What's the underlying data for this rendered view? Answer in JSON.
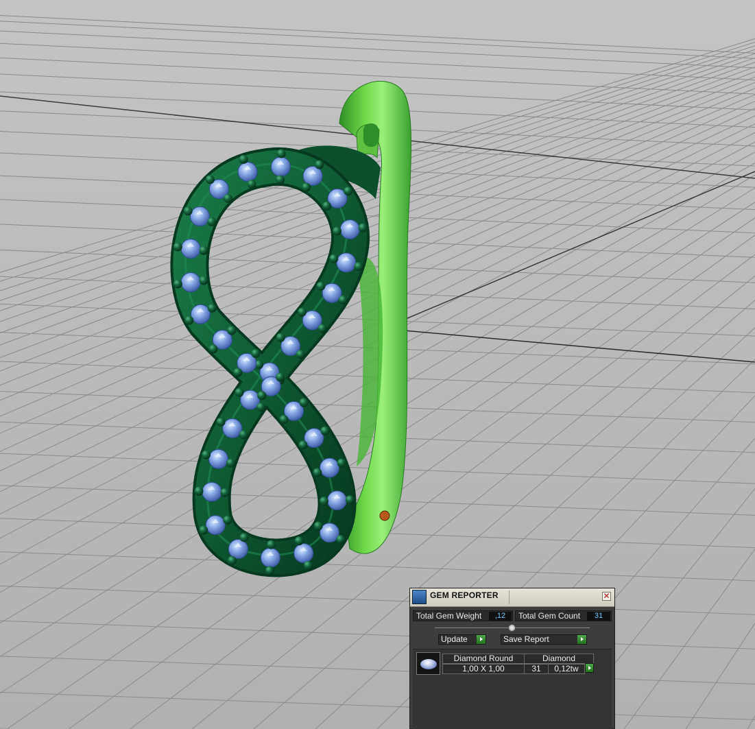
{
  "panel": {
    "title": "GEM REPORTER",
    "close_glyph": "✕",
    "icon": "gem-reporter-icon",
    "total_weight_label": "Total Gem Weight",
    "total_weight_value": ",12",
    "total_count_label": "Total Gem Count",
    "total_count_value": "31",
    "update_label": "Update",
    "save_label": "Save Report"
  },
  "gems": [
    {
      "shape": "Diamond Round",
      "material": "Diamond",
      "size": "1,00 X 1,00",
      "count": "31",
      "weight": "0,12tw"
    }
  ],
  "colors": {
    "metal_bright": "#5ec83c",
    "metal_dark": "#0f5b35",
    "gem": "#7fa6e0",
    "prong": "#14603c",
    "grid_bg": "#b8b8b8",
    "panel_bg": "#3d3d3d",
    "value_text": "#6fc6ff"
  }
}
